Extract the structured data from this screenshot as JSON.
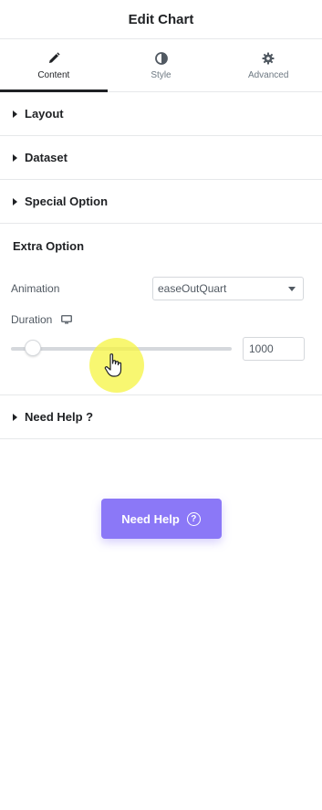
{
  "header": {
    "title": "Edit Chart"
  },
  "tabs": [
    {
      "label": "Content",
      "icon": "pencil-icon",
      "active": true
    },
    {
      "label": "Style",
      "icon": "contrast-icon",
      "active": false
    },
    {
      "label": "Advanced",
      "icon": "gear-icon",
      "active": false
    }
  ],
  "sections": {
    "layout": "Layout",
    "dataset": "Dataset",
    "special_option": "Special Option",
    "extra_option": "Extra Option",
    "need_help": "Need Help ?"
  },
  "extra_option": {
    "animation_label": "Animation",
    "animation_value": "easeOutQuart",
    "duration_label": "Duration",
    "duration_value": "1000",
    "duration_slider_fraction": 0.1
  },
  "help_button": {
    "label": "Need Help",
    "icon": "question-circle-icon"
  },
  "colors": {
    "accent": "#8b78f7",
    "cursor_highlight": "#f5f442"
  }
}
